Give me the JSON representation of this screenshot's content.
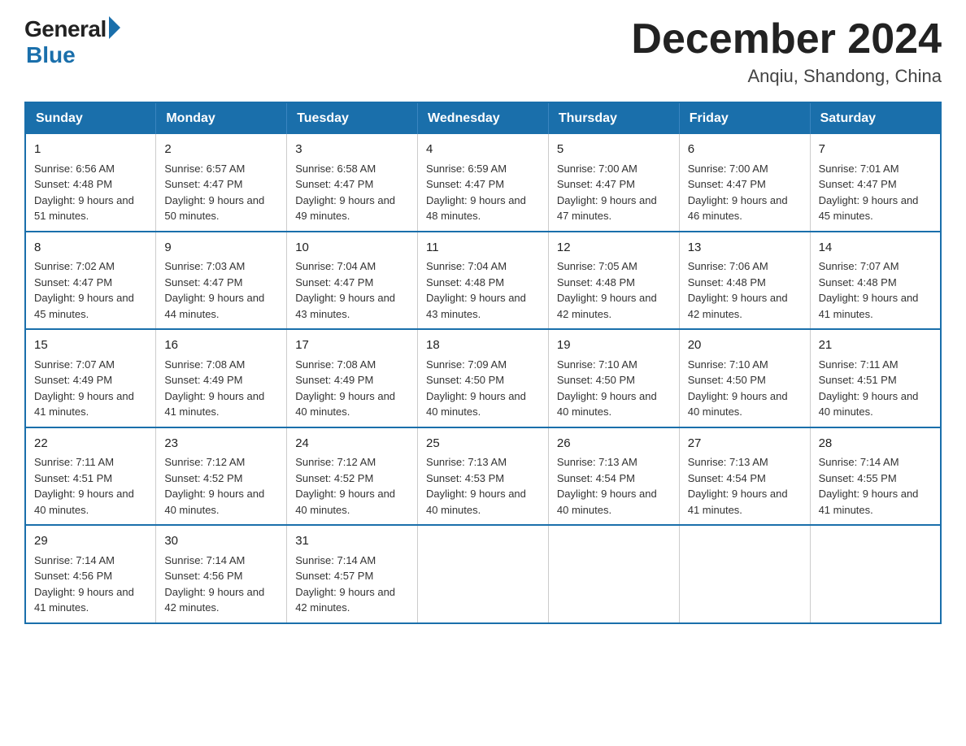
{
  "logo": {
    "general": "General",
    "blue": "Blue"
  },
  "title": "December 2024",
  "location": "Anqiu, Shandong, China",
  "days_of_week": [
    "Sunday",
    "Monday",
    "Tuesday",
    "Wednesday",
    "Thursday",
    "Friday",
    "Saturday"
  ],
  "weeks": [
    [
      {
        "day": "1",
        "sunrise": "Sunrise: 6:56 AM",
        "sunset": "Sunset: 4:48 PM",
        "daylight": "Daylight: 9 hours and 51 minutes."
      },
      {
        "day": "2",
        "sunrise": "Sunrise: 6:57 AM",
        "sunset": "Sunset: 4:47 PM",
        "daylight": "Daylight: 9 hours and 50 minutes."
      },
      {
        "day": "3",
        "sunrise": "Sunrise: 6:58 AM",
        "sunset": "Sunset: 4:47 PM",
        "daylight": "Daylight: 9 hours and 49 minutes."
      },
      {
        "day": "4",
        "sunrise": "Sunrise: 6:59 AM",
        "sunset": "Sunset: 4:47 PM",
        "daylight": "Daylight: 9 hours and 48 minutes."
      },
      {
        "day": "5",
        "sunrise": "Sunrise: 7:00 AM",
        "sunset": "Sunset: 4:47 PM",
        "daylight": "Daylight: 9 hours and 47 minutes."
      },
      {
        "day": "6",
        "sunrise": "Sunrise: 7:00 AM",
        "sunset": "Sunset: 4:47 PM",
        "daylight": "Daylight: 9 hours and 46 minutes."
      },
      {
        "day": "7",
        "sunrise": "Sunrise: 7:01 AM",
        "sunset": "Sunset: 4:47 PM",
        "daylight": "Daylight: 9 hours and 45 minutes."
      }
    ],
    [
      {
        "day": "8",
        "sunrise": "Sunrise: 7:02 AM",
        "sunset": "Sunset: 4:47 PM",
        "daylight": "Daylight: 9 hours and 45 minutes."
      },
      {
        "day": "9",
        "sunrise": "Sunrise: 7:03 AM",
        "sunset": "Sunset: 4:47 PM",
        "daylight": "Daylight: 9 hours and 44 minutes."
      },
      {
        "day": "10",
        "sunrise": "Sunrise: 7:04 AM",
        "sunset": "Sunset: 4:47 PM",
        "daylight": "Daylight: 9 hours and 43 minutes."
      },
      {
        "day": "11",
        "sunrise": "Sunrise: 7:04 AM",
        "sunset": "Sunset: 4:48 PM",
        "daylight": "Daylight: 9 hours and 43 minutes."
      },
      {
        "day": "12",
        "sunrise": "Sunrise: 7:05 AM",
        "sunset": "Sunset: 4:48 PM",
        "daylight": "Daylight: 9 hours and 42 minutes."
      },
      {
        "day": "13",
        "sunrise": "Sunrise: 7:06 AM",
        "sunset": "Sunset: 4:48 PM",
        "daylight": "Daylight: 9 hours and 42 minutes."
      },
      {
        "day": "14",
        "sunrise": "Sunrise: 7:07 AM",
        "sunset": "Sunset: 4:48 PM",
        "daylight": "Daylight: 9 hours and 41 minutes."
      }
    ],
    [
      {
        "day": "15",
        "sunrise": "Sunrise: 7:07 AM",
        "sunset": "Sunset: 4:49 PM",
        "daylight": "Daylight: 9 hours and 41 minutes."
      },
      {
        "day": "16",
        "sunrise": "Sunrise: 7:08 AM",
        "sunset": "Sunset: 4:49 PM",
        "daylight": "Daylight: 9 hours and 41 minutes."
      },
      {
        "day": "17",
        "sunrise": "Sunrise: 7:08 AM",
        "sunset": "Sunset: 4:49 PM",
        "daylight": "Daylight: 9 hours and 40 minutes."
      },
      {
        "day": "18",
        "sunrise": "Sunrise: 7:09 AM",
        "sunset": "Sunset: 4:50 PM",
        "daylight": "Daylight: 9 hours and 40 minutes."
      },
      {
        "day": "19",
        "sunrise": "Sunrise: 7:10 AM",
        "sunset": "Sunset: 4:50 PM",
        "daylight": "Daylight: 9 hours and 40 minutes."
      },
      {
        "day": "20",
        "sunrise": "Sunrise: 7:10 AM",
        "sunset": "Sunset: 4:50 PM",
        "daylight": "Daylight: 9 hours and 40 minutes."
      },
      {
        "day": "21",
        "sunrise": "Sunrise: 7:11 AM",
        "sunset": "Sunset: 4:51 PM",
        "daylight": "Daylight: 9 hours and 40 minutes."
      }
    ],
    [
      {
        "day": "22",
        "sunrise": "Sunrise: 7:11 AM",
        "sunset": "Sunset: 4:51 PM",
        "daylight": "Daylight: 9 hours and 40 minutes."
      },
      {
        "day": "23",
        "sunrise": "Sunrise: 7:12 AM",
        "sunset": "Sunset: 4:52 PM",
        "daylight": "Daylight: 9 hours and 40 minutes."
      },
      {
        "day": "24",
        "sunrise": "Sunrise: 7:12 AM",
        "sunset": "Sunset: 4:52 PM",
        "daylight": "Daylight: 9 hours and 40 minutes."
      },
      {
        "day": "25",
        "sunrise": "Sunrise: 7:13 AM",
        "sunset": "Sunset: 4:53 PM",
        "daylight": "Daylight: 9 hours and 40 minutes."
      },
      {
        "day": "26",
        "sunrise": "Sunrise: 7:13 AM",
        "sunset": "Sunset: 4:54 PM",
        "daylight": "Daylight: 9 hours and 40 minutes."
      },
      {
        "day": "27",
        "sunrise": "Sunrise: 7:13 AM",
        "sunset": "Sunset: 4:54 PM",
        "daylight": "Daylight: 9 hours and 41 minutes."
      },
      {
        "day": "28",
        "sunrise": "Sunrise: 7:14 AM",
        "sunset": "Sunset: 4:55 PM",
        "daylight": "Daylight: 9 hours and 41 minutes."
      }
    ],
    [
      {
        "day": "29",
        "sunrise": "Sunrise: 7:14 AM",
        "sunset": "Sunset: 4:56 PM",
        "daylight": "Daylight: 9 hours and 41 minutes."
      },
      {
        "day": "30",
        "sunrise": "Sunrise: 7:14 AM",
        "sunset": "Sunset: 4:56 PM",
        "daylight": "Daylight: 9 hours and 42 minutes."
      },
      {
        "day": "31",
        "sunrise": "Sunrise: 7:14 AM",
        "sunset": "Sunset: 4:57 PM",
        "daylight": "Daylight: 9 hours and 42 minutes."
      },
      null,
      null,
      null,
      null
    ]
  ]
}
